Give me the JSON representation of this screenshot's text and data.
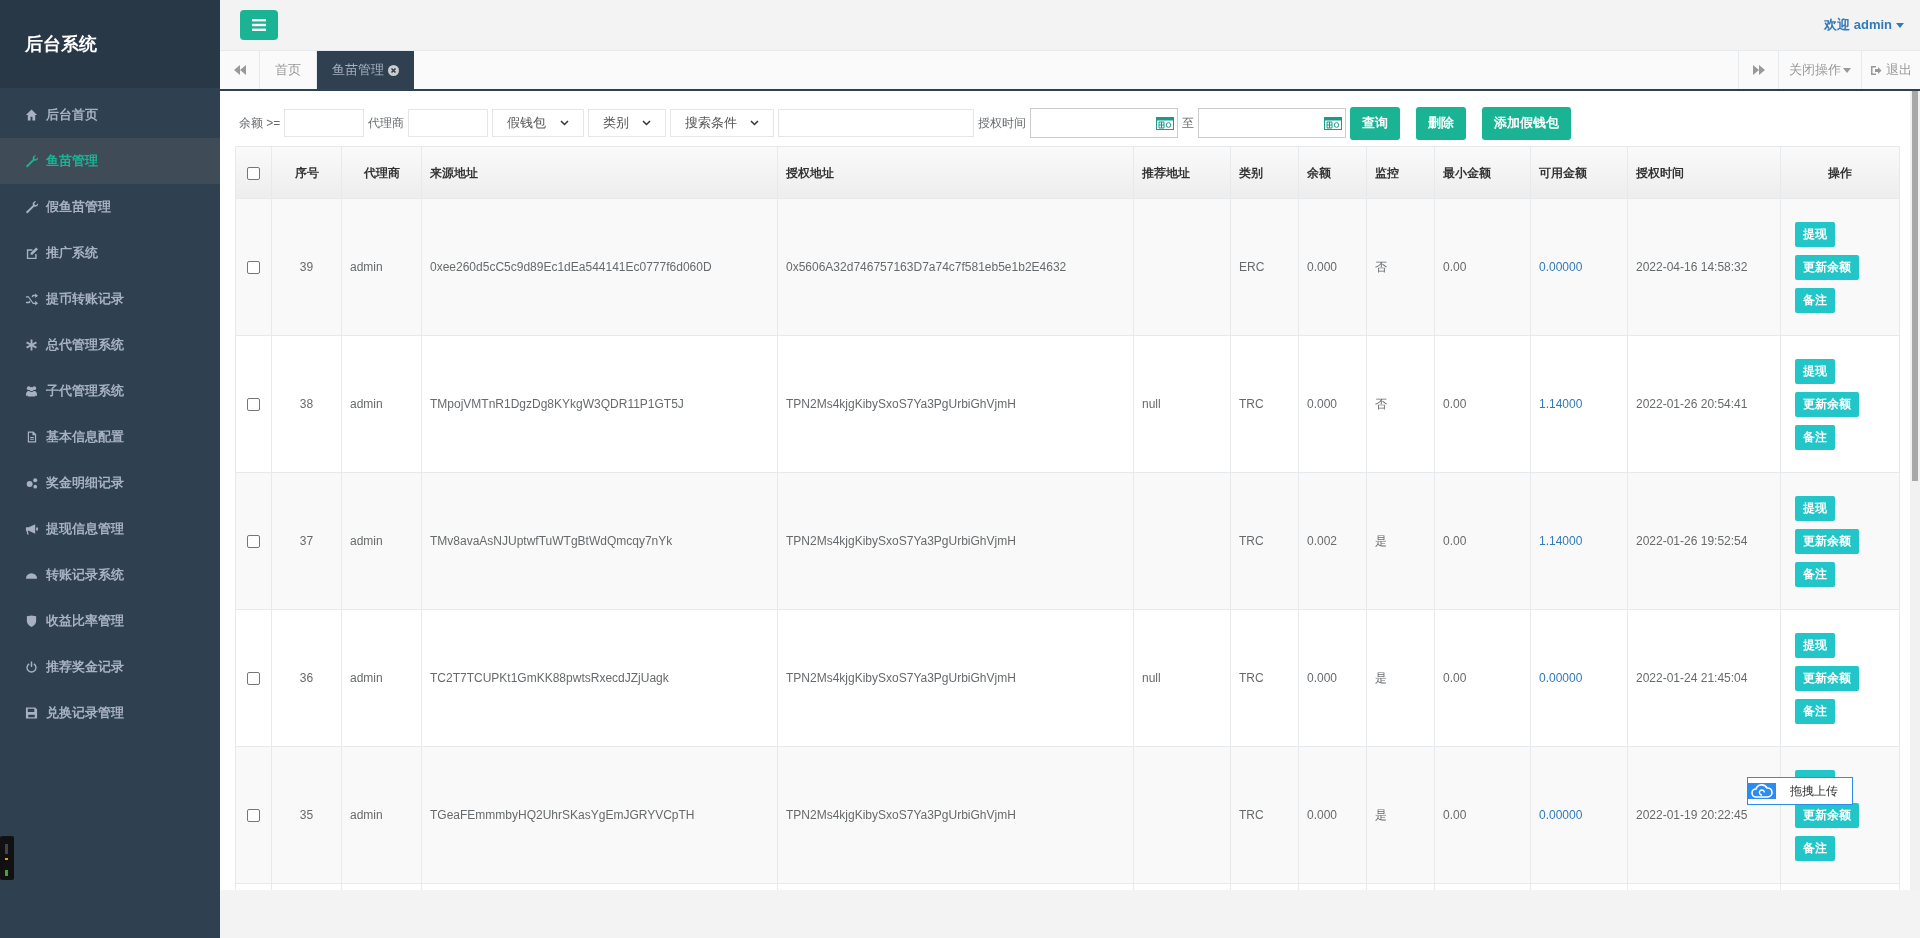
{
  "sidebar": {
    "title": "后台系统",
    "items": [
      {
        "label": "后台首页",
        "selected": false
      },
      {
        "label": "鱼苗管理",
        "selected": true
      },
      {
        "label": "假鱼苗管理",
        "selected": false
      },
      {
        "label": "推广系统",
        "selected": false
      },
      {
        "label": "提币转账记录",
        "selected": false
      },
      {
        "label": "总代管理系统",
        "selected": false
      },
      {
        "label": "子代管理系统",
        "selected": false
      },
      {
        "label": "基本信息配置",
        "selected": false
      },
      {
        "label": "奖金明细记录",
        "selected": false
      },
      {
        "label": "提现信息管理",
        "selected": false
      },
      {
        "label": "转账记录系统",
        "selected": false
      },
      {
        "label": "收益比率管理",
        "selected": false
      },
      {
        "label": "推荐奖金记录",
        "selected": false
      },
      {
        "label": "兑换记录管理",
        "selected": false
      }
    ]
  },
  "header": {
    "welcome": "欢迎",
    "user": "admin"
  },
  "tabs": [
    {
      "label": "首页",
      "selected": false,
      "closable": false
    },
    {
      "label": "鱼苗管理",
      "selected": true,
      "closable": true
    }
  ],
  "tab_actions": {
    "close_menu": "关闭操作",
    "logout": "退出"
  },
  "filters": {
    "balance_label": "余额 >=",
    "agent_label": "代理商",
    "wallet_select": "假钱包",
    "type_select": "类别",
    "condition_select": "搜索条件",
    "time_label": "授权时间",
    "to_label": "至",
    "buttons": [
      {
        "label": "查询"
      },
      {
        "label": "删除"
      },
      {
        "label": "添加假钱包"
      }
    ]
  },
  "table": {
    "select_all_checked": false,
    "columns": [
      "序号",
      "代理商",
      "来源地址",
      "授权地址",
      "推荐地址",
      "类别",
      "余额",
      "监控",
      "最小金额",
      "可用金额",
      "授权时间",
      "操作"
    ],
    "rows": [
      {
        "checked": false,
        "cells": [
          "39",
          "admin",
          "0xee260d5cC5c9d89Ec1dEa544141Ec0777f6d060D",
          "0x5606A32d746757163D7a74c7f581eb5e1b2E4632",
          null,
          "ERC",
          "0.000",
          "否",
          "0.00",
          "0.00000",
          "2022-04-16 14:58:32"
        ],
        "actions": [
          "提现",
          "更新余额",
          "备注"
        ]
      },
      {
        "checked": false,
        "cells": [
          "38",
          "admin",
          "TMpojVMTnR1DgzDg8KYkgW3QDR11P1GT5J",
          "TPN2Ms4kjgKibySxoS7Ya3PgUrbiGhVjmH",
          "null",
          "TRC",
          "0.000",
          "否",
          "0.00",
          "1.14000",
          "2022-01-26 20:54:41"
        ],
        "actions": [
          "提现",
          "更新余额",
          "备注"
        ]
      },
      {
        "checked": false,
        "cells": [
          "37",
          "admin",
          "TMv8avaAsNJUptwfTuWTgBtWdQmcqy7nYk",
          "TPN2Ms4kjgKibySxoS7Ya3PgUrbiGhVjmH",
          null,
          "TRC",
          "0.002",
          "是",
          "0.00",
          "1.14000",
          "2022-01-26 19:52:54"
        ],
        "actions": [
          "提现",
          "更新余额",
          "备注"
        ]
      },
      {
        "checked": false,
        "cells": [
          "36",
          "admin",
          "TC2T7TCUPKt1GmKK88pwtsRxecdJZjUagk",
          "TPN2Ms4kjgKibySxoS7Ya3PgUrbiGhVjmH",
          "null",
          "TRC",
          "0.000",
          "是",
          "0.00",
          "0.00000",
          "2022-01-24 21:45:04"
        ],
        "actions": [
          "提现",
          "更新余额",
          "备注"
        ]
      },
      {
        "checked": false,
        "cells": [
          "35",
          "admin",
          "TGeaFEmmmbyHQ2UhrSKasYgEmJGRYVCpTH",
          "TPN2Ms4kjgKibySxoS7Ya3PgUrbiGhVjmH",
          null,
          "TRC",
          "0.000",
          "是",
          "0.00",
          "0.00000",
          "2022-01-19 20:22:45"
        ],
        "covered_action": true,
        "actions": [
          "更新余额",
          "备注"
        ]
      }
    ]
  },
  "upload_widget": {
    "label": "拖拽上传"
  }
}
